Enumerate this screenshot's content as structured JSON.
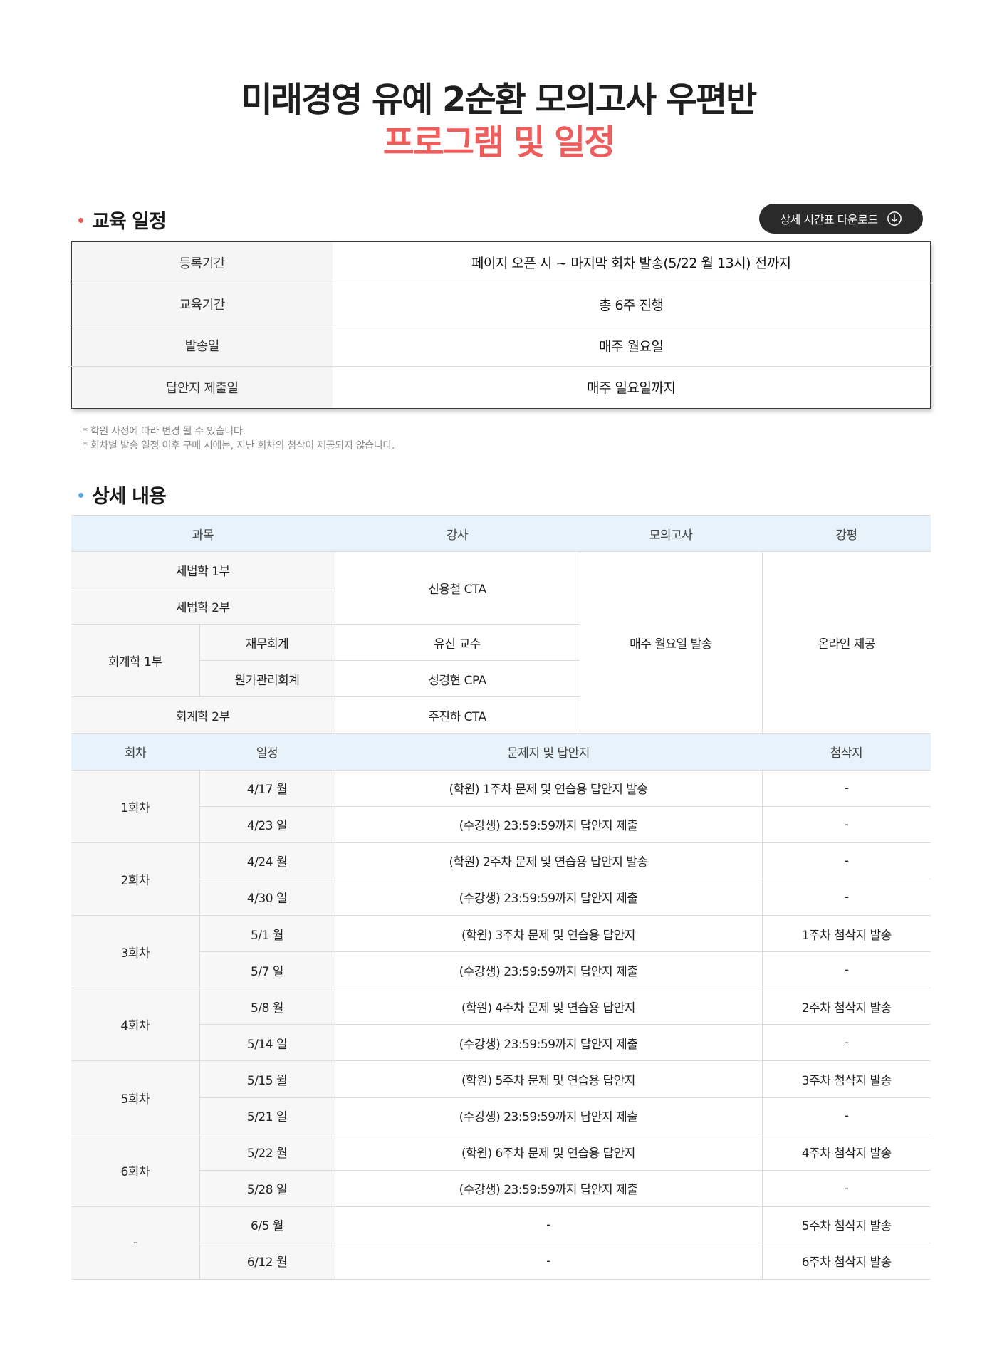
{
  "title": {
    "main": "미래경영 유예 2순환 모의고사 우편반",
    "sub": "프로그램 및 일정"
  },
  "colors": {
    "accent_red": "#ef5c5c",
    "accent_blue": "#5aa8e0",
    "header_blue": "#e8f2fa",
    "button_dark": "#2a2a2a"
  },
  "section_schedule": {
    "heading": "교육 일정",
    "download_button": "상세 시간표 다운로드",
    "rows": [
      {
        "label": "등록기간",
        "value": "페이지 오픈 시 ~ 마지막 회차 발송(5/22 월 13시) 전까지"
      },
      {
        "label": "교육기간",
        "value": "총 6주 진행"
      },
      {
        "label": "발송일",
        "value": "매주 월요일"
      },
      {
        "label": "답안지 제출일",
        "value": "매주 일요일까지"
      }
    ],
    "notes": [
      "* 학원 사정에 따라 변경 될 수 있습니다.",
      "* 회차별 발송 일정 이후 구매 시에는, 지난 회차의 첨삭이 제공되지 않습니다."
    ]
  },
  "section_detail": {
    "heading": "상세 내용",
    "header1": {
      "subject": "과목",
      "lecturer": "강사",
      "mock": "모의고사",
      "review": "강평"
    },
    "subjects": {
      "tax1": "세법학 1부",
      "tax2": "세법학 2부",
      "acc1": "회계학 1부",
      "acc1_fin": "재무회계",
      "acc1_cost": "원가관리회계",
      "acc2": "회계학 2부"
    },
    "lecturers": {
      "tax": "신용철 CTA",
      "fin": "유신 교수",
      "cost": "성경현 CPA",
      "acc2": "주진하 CTA"
    },
    "mock_value": "매주 월요일 발송",
    "review_value": "온라인 제공",
    "header2": {
      "round": "회차",
      "date": "일정",
      "material": "문제지 및 답안지",
      "correction": "첨삭지"
    },
    "rounds": [
      {
        "name": "1회차",
        "rows": [
          {
            "date": "4/17 월",
            "material": "(학원) 1주차 문제 및 연습용 답안지 발송",
            "correction": "-"
          },
          {
            "date": "4/23 일",
            "material": "(수강생) 23:59:59까지 답안지 제출",
            "correction": "-"
          }
        ]
      },
      {
        "name": "2회차",
        "rows": [
          {
            "date": "4/24 월",
            "material": "(학원) 2주차 문제 및 연습용 답안지 발송",
            "correction": "-"
          },
          {
            "date": "4/30 일",
            "material": "(수강생) 23:59:59까지 답안지 제출",
            "correction": "-"
          }
        ]
      },
      {
        "name": "3회차",
        "rows": [
          {
            "date": "5/1 월",
            "material": "(학원) 3주차 문제 및 연습용 답안지",
            "correction": "1주차 첨삭지 발송"
          },
          {
            "date": "5/7 일",
            "material": "(수강생) 23:59:59까지 답안지 제출",
            "correction": "-"
          }
        ]
      },
      {
        "name": "4회차",
        "rows": [
          {
            "date": "5/8 월",
            "material": "(학원) 4주차 문제 및 연습용 답안지",
            "correction": "2주차 첨삭지 발송"
          },
          {
            "date": "5/14 일",
            "material": "(수강생) 23:59:59까지 답안지 제출",
            "correction": "-"
          }
        ]
      },
      {
        "name": "5회차",
        "rows": [
          {
            "date": "5/15 월",
            "material": "(학원) 5주차 문제 및 연습용 답안지",
            "correction": "3주차 첨삭지 발송"
          },
          {
            "date": "5/21 일",
            "material": "(수강생) 23:59:59까지 답안지 제출",
            "correction": "-"
          }
        ]
      },
      {
        "name": "6회차",
        "rows": [
          {
            "date": "5/22 월",
            "material": "(학원) 6주차 문제 및 연습용 답안지",
            "correction": "4주차 첨삭지 발송"
          },
          {
            "date": "5/28 일",
            "material": "(수강생) 23:59:59까지 답안지 제출",
            "correction": "-"
          }
        ]
      },
      {
        "name": "-",
        "rows": [
          {
            "date": "6/5 월",
            "material": "-",
            "correction": "5주차 첨삭지 발송"
          },
          {
            "date": "6/12 월",
            "material": "-",
            "correction": "6주차 첨삭지 발송"
          }
        ]
      }
    ]
  }
}
